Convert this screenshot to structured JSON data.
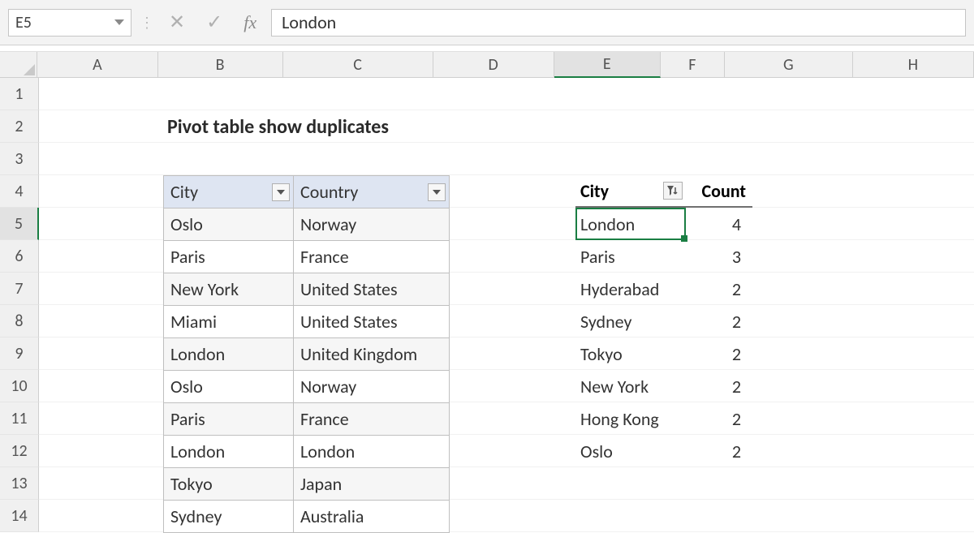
{
  "formulaBar": {
    "nameBox": "E5",
    "value": "London"
  },
  "columnHeaders": [
    "A",
    "B",
    "C",
    "D",
    "E",
    "F",
    "G",
    "H"
  ],
  "rowHeaders": [
    "1",
    "2",
    "3",
    "4",
    "5",
    "6",
    "7",
    "8",
    "9",
    "10",
    "11",
    "12",
    "13",
    "14"
  ],
  "selected": {
    "col": "E",
    "row": "5"
  },
  "title": "Pivot table show duplicates",
  "dataTable": {
    "headers": {
      "city": "City",
      "country": "Country"
    },
    "rows": [
      {
        "city": "Oslo",
        "country": "Norway"
      },
      {
        "city": "Paris",
        "country": "France"
      },
      {
        "city": "New York",
        "country": "United States"
      },
      {
        "city": "Miami",
        "country": "United States"
      },
      {
        "city": "London",
        "country": "United Kingdom"
      },
      {
        "city": "Oslo",
        "country": "Norway"
      },
      {
        "city": "Paris",
        "country": "France"
      },
      {
        "city": "London",
        "country": "London"
      },
      {
        "city": "Tokyo",
        "country": "Japan"
      },
      {
        "city": "Sydney",
        "country": "Australia"
      }
    ]
  },
  "pivot": {
    "headers": {
      "city": "City",
      "count": "Count"
    },
    "rows": [
      {
        "city": "London",
        "count": 4
      },
      {
        "city": "Paris",
        "count": 3
      },
      {
        "city": "Hyderabad",
        "count": 2
      },
      {
        "city": "Sydney",
        "count": 2
      },
      {
        "city": "Tokyo",
        "count": 2
      },
      {
        "city": "New York",
        "count": 2
      },
      {
        "city": "Hong Kong",
        "count": 2
      },
      {
        "city": "Oslo",
        "count": 2
      }
    ]
  }
}
